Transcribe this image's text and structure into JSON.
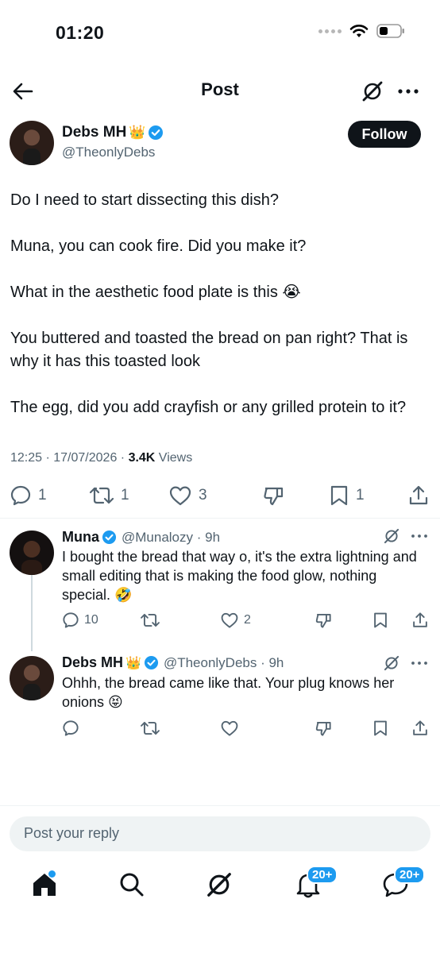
{
  "status_bar": {
    "time": "01:20"
  },
  "header": {
    "title": "Post"
  },
  "post": {
    "author_name": "Debs MH",
    "author_emoji": "👑",
    "author_handle": "@TheonlyDebs",
    "follow_label": "Follow",
    "paragraphs": [
      "Do I need to start dissecting this dish?",
      "Muna, you can cook fire. Did you make it?",
      "What in the aesthetic food plate is this 😭",
      "You buttered and toasted the bread on pan right?  That is why it has this toasted look",
      "The egg, did you add crayfish or any grilled protein to it?"
    ],
    "timestamp": "12:25 · 17/07/2026 · ",
    "views_count": "3.4K",
    "views_label": " Views",
    "replies": "1",
    "reposts": "1",
    "likes": "3",
    "bookmarks": "1"
  },
  "replies": [
    {
      "name": "Muna",
      "handle": "@Munalozy · 9h",
      "text": "I bought the bread that way o, it's the extra lightning and small editing that is making the food glow, nothing special. 🤣",
      "reply_count": "10",
      "like_count": "2"
    },
    {
      "name": "Debs MH",
      "emoji": "👑",
      "handle": "@TheonlyDebs · 9h",
      "text": "Ohhh, the bread came like that. Your plug knows her onions 😝"
    }
  ],
  "reply_box": {
    "placeholder": "Post your reply"
  },
  "bottom_nav": {
    "notifications_badge": "20+",
    "messages_badge": "20+"
  },
  "colors": {
    "accent": "#1d9bf0",
    "text": "#0f1419",
    "muted": "#536471"
  }
}
